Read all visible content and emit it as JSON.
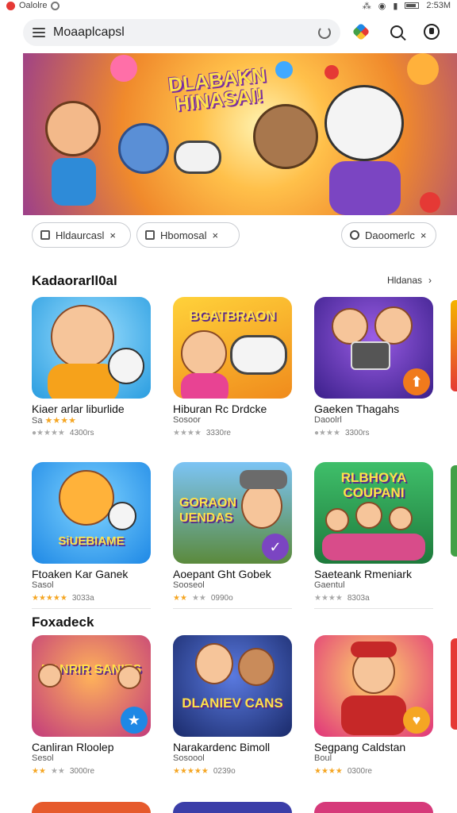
{
  "status_bar": {
    "left_label": "Oalolre",
    "time": "2:53M"
  },
  "search": {
    "value": "Moaaplcapsl"
  },
  "icons": {
    "menu": "menu-icon",
    "refresh": "refresh-icon",
    "store": "play-store-icon",
    "search": "search-icon",
    "account": "account-icon"
  },
  "banner": {
    "title": "DLABAKN HINASAI!"
  },
  "chips": [
    {
      "label": "Hldaurcasl"
    },
    {
      "label": "Hbomosal"
    },
    {
      "label": "Daoomerlc"
    }
  ],
  "section1": {
    "title": "Kadaorarll0al",
    "link": "Hldanas"
  },
  "section2": {
    "title": "Foxadeck"
  },
  "colors": {
    "accent": "#f5a623",
    "chip_border": "#c9ccd1"
  },
  "apps_row1": [
    {
      "name": "Kiaer arlar liburlide",
      "sub": "Sa",
      "meta": "4300rs",
      "art_text": ""
    },
    {
      "name": "Hiburan Rc Drdcke",
      "sub": "Sosoor",
      "meta": "3330re",
      "art_text": "BGATBRAON"
    },
    {
      "name": "Gaeken Thagahs",
      "sub": "Daoolrl",
      "meta": "3300rs",
      "art_text": ""
    }
  ],
  "apps_row2": [
    {
      "name": "Ftoaken Kar Ganek",
      "sub": "Sasol",
      "meta": "3033a",
      "art_text": "SiUEBIAME"
    },
    {
      "name": "Aoepant Ght Gobek",
      "sub": "Sooseol",
      "meta": "0990o",
      "art_text": "GORAON UENDAS"
    },
    {
      "name": "Saeteank Rmeniark",
      "sub": "Gaentul",
      "meta": "8303a",
      "art_text": "RLBHOYA COUPANI"
    }
  ],
  "apps_row3": [
    {
      "name": "Canliran Rloolep",
      "sub": "Sesol",
      "meta": "3000re",
      "art_text": "NANRIR SANIES"
    },
    {
      "name": "Narakardenc Bimoll",
      "sub": "Sosoool",
      "meta": "0239o",
      "art_text": "DLANIEV CANS"
    },
    {
      "name": "Segpang Caldstan",
      "sub": "Boul",
      "meta": "0300re",
      "art_text": ""
    }
  ]
}
